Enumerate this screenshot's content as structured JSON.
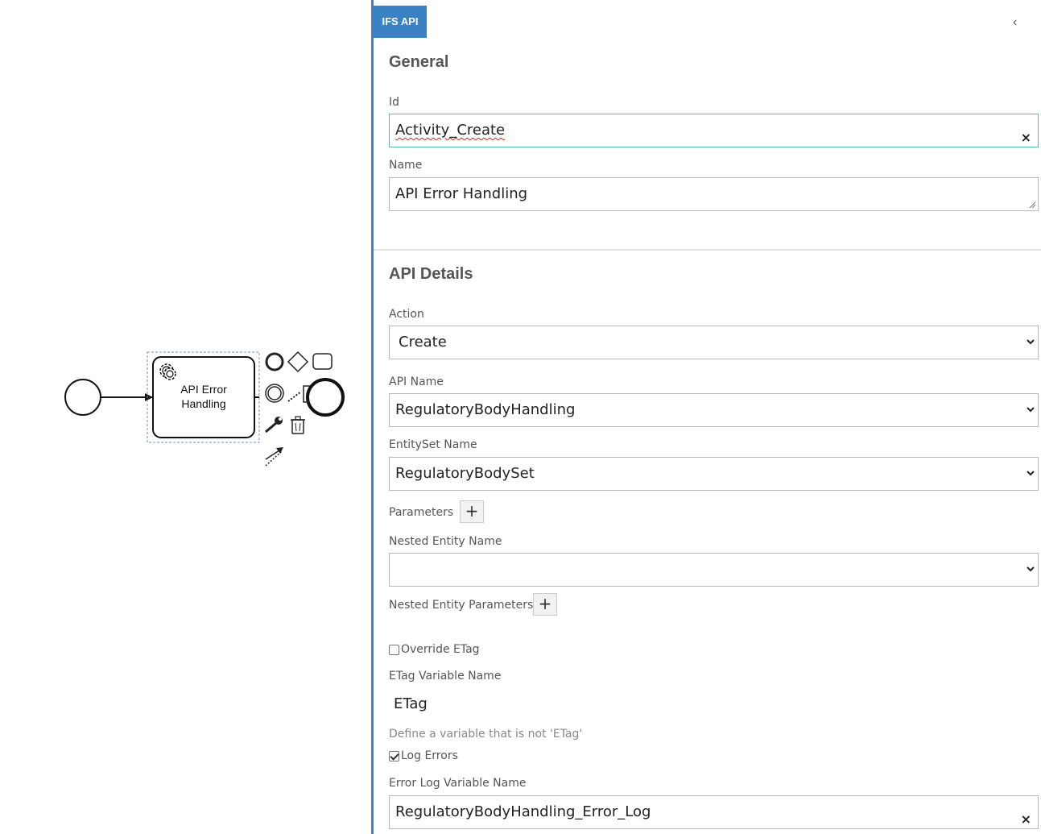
{
  "diagram": {
    "task_label_line1": "API Error",
    "task_label_line2": "Handling"
  },
  "panel": {
    "tab_label": "IFS API",
    "nav_prev": "‹",
    "general": {
      "title": "General",
      "id_label": "Id",
      "id_value": "Activity_Create",
      "name_label": "Name",
      "name_value": "API Error Handling"
    },
    "api_details": {
      "title": "API Details",
      "action_label": "Action",
      "action_value": "Create",
      "api_name_label": "API Name",
      "api_name_value": "RegulatoryBodyHandling",
      "entityset_label": "EntitySet Name",
      "entityset_value": "RegulatoryBodySet",
      "parameters_label": "Parameters",
      "nested_entity_label": "Nested Entity Name",
      "nested_entity_value": "",
      "nested_params_label": "Nested Entity Parameters",
      "override_etag_label": "Override ETag",
      "override_etag_checked": false,
      "etag_var_label": "ETag Variable Name",
      "etag_var_value": "ETag",
      "etag_hint": "Define a variable that is not 'ETag'",
      "log_errors_label": "Log Errors",
      "log_errors_checked": true,
      "error_log_label": "Error Log Variable Name",
      "error_log_value": "RegulatoryBodyHandling_Error_Log"
    }
  },
  "colors": {
    "accent": "#3b82c4",
    "focus_border": "#52bfa0"
  }
}
